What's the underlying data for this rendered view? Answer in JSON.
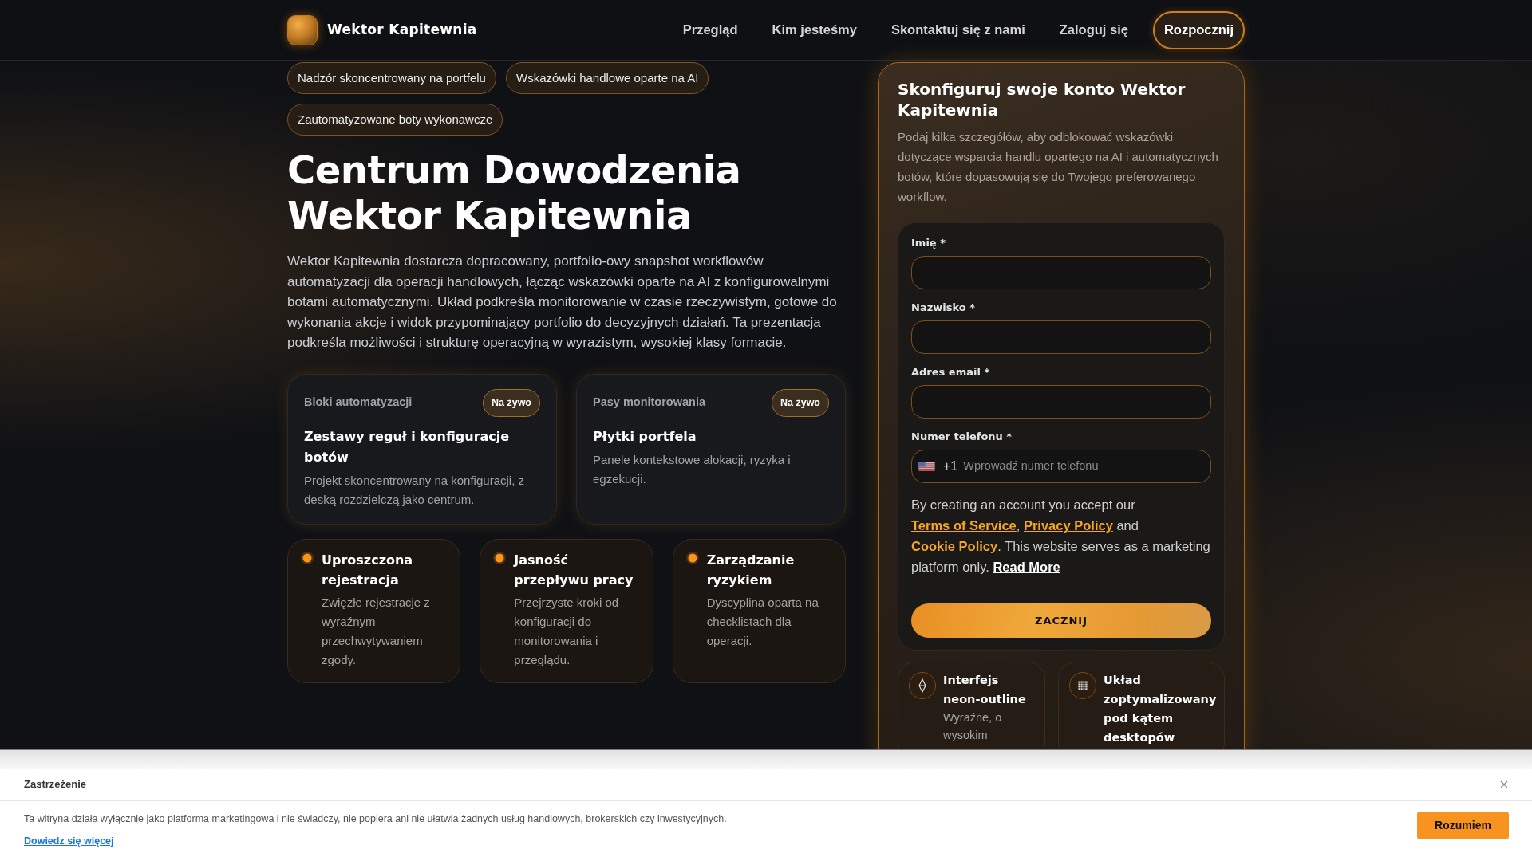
{
  "header": {
    "brand": "Wektor Kapitewnia",
    "nav": [
      {
        "label": "Przegląd",
        "kind": "link"
      },
      {
        "label": "Kim jesteśmy",
        "kind": "link"
      },
      {
        "label": "Skontaktuj się z nami",
        "kind": "link"
      },
      {
        "label": "Zaloguj się",
        "kind": "link"
      },
      {
        "label": "Rozpocznij",
        "kind": "button"
      }
    ]
  },
  "tags": [
    "Nadzór skoncentrowany na portfelu",
    "Wskazówki handlowe oparte na AI",
    "Zautomatyzowane boty wykonawcze"
  ],
  "hero": {
    "title": "Centrum Dowodzenia Wektor Kapitewnia",
    "description": "Wektor Kapitewnia dostarcza dopracowany, portfolio-owy snapshot workflowów automatyzacji dla operacji handlowych, łącząc wskazówki oparte na AI z konfigurowalnymi botami automatycznymi. Układ podkreśla monitorowanie w czasie rzeczywistym, gotowe do wykonania akcje i widok przypominający portfolio do decyzyjnych działań. Ta prezentacja podkreśla możliwości i strukturę operacyjną w wyrazistym, wysokiej klasy formacie."
  },
  "highlight_cards": [
    {
      "label": "Bloki automatyzacji",
      "badge": "Na żywo",
      "title": "Zestawy reguł i konfiguracje botów",
      "description": "Projekt skoncentrowany na konfiguracji, z deską rozdzielczą jako centrum."
    },
    {
      "label": "Pasy monitorowania",
      "badge": "Na żywo",
      "title": "Płytki portfela",
      "description": "Panele kontekstowe alokacji, ryzyka i egzekucji."
    }
  ],
  "feature_cards": [
    {
      "title": "Uproszczona rejestracja",
      "description": "Zwięzłe rejestracje z wyraźnym przechwytywaniem zgody."
    },
    {
      "title": "Jasność przepływu pracy",
      "description": "Przejrzyste kroki od konfiguracji do monitorowania i przeglądu."
    },
    {
      "title": "Zarządzanie ryzykiem",
      "description": "Dyscyplina oparta na checklistach dla operacji."
    }
  ],
  "signup": {
    "title": "Skonfiguruj swoje konto Wektor Kapitewnia",
    "description": "Podaj kilka szczegółów, aby odblokować wskazówki dotyczące wsparcia handlu opartego na AI i automatycznych botów, które dopasowują się do Twojego preferowanego workflow.",
    "fields": [
      {
        "label": "Imię *",
        "kind": "text"
      },
      {
        "label": "Nazwisko *",
        "kind": "text"
      },
      {
        "label": "Adres email *",
        "kind": "text"
      },
      {
        "label": "Numer telefonu *",
        "kind": "phone",
        "dial_code": "+1",
        "placeholder": "Wprowadź numer telefonu"
      }
    ],
    "consent": [
      {
        "kind": "text",
        "text": "By creating an account you accept our "
      },
      {
        "kind": "link",
        "text": "Terms of Service"
      },
      {
        "kind": "text",
        "text": ", "
      },
      {
        "kind": "link",
        "text": "Privacy Policy"
      },
      {
        "kind": "text",
        "text": " and "
      },
      {
        "kind": "link",
        "text": "Cookie Policy"
      },
      {
        "kind": "text",
        "text": ". This website serves as a marketing platform only. "
      },
      {
        "kind": "more_link",
        "text": "Read More"
      }
    ],
    "submit": "ZACZNIJ"
  },
  "extra_features": [
    {
      "title": "Interfejs neon-outline",
      "description": "Wyraźne, o wysokim"
    },
    {
      "title": "Układ zoptymalizowany pod kątem desktopów"
    }
  ],
  "disclaimer": {
    "title": "Zastrzeżenie",
    "text": "Ta witryna działa wyłącznie jako platforma marketingowa i nie świadczy, nie popiera ani nie ułatwia żadnych usług handlowych, brokerskich czy inwestycyjnych.",
    "link": "Dowiedz się więcej",
    "button": "Rozumiem"
  }
}
